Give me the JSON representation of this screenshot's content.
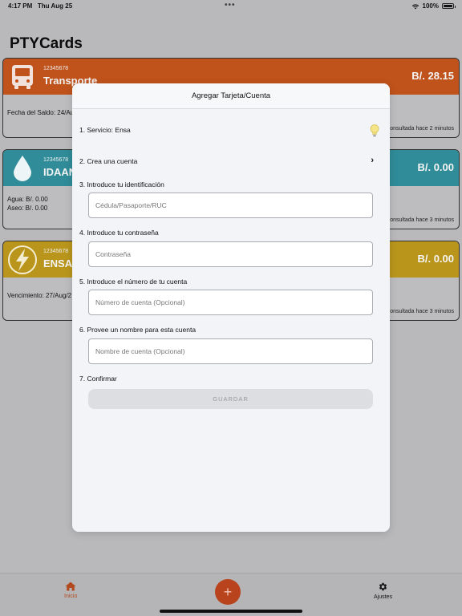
{
  "status_bar": {
    "time": "4:17 PM",
    "date": "Thu Aug 25",
    "battery": "100%"
  },
  "app": {
    "title": "PTYCards"
  },
  "cards": [
    {
      "number": "12345678",
      "name": "Transporte",
      "amount": "B/. 28.15",
      "detail_lines": [
        "Fecha del Saldo: 24/Au"
      ],
      "updated": "consultada hace 2 minutos"
    },
    {
      "number": "12345678",
      "name": "IDAAN",
      "amount": "B/. 0.00",
      "detail_lines": [
        "Agua: B/. 0.00",
        "Aseo: B/. 0.00"
      ],
      "updated": "consultada hace 3 minutos"
    },
    {
      "number": "12345678",
      "name": "ENSA",
      "amount": "B/. 0.00",
      "detail_lines": [
        "Vencimiento: 27/Aug/2"
      ],
      "updated": "consultada hace 3 minutos"
    }
  ],
  "modal": {
    "title": "Agregar Tarjeta/Cuenta",
    "step1": "1. Servicio: Ensa",
    "step2": "2. Crea una cuenta",
    "step3": "3. Introduce tu identificación",
    "step3_placeholder": "Cédula/Pasaporte/RUC",
    "step4": "4. Introduce tu contraseña",
    "step4_placeholder": "Contraseña",
    "step5": "5. Introduce el número de tu cuenta",
    "step5_placeholder": "Número de cuenta (Opcional)",
    "step6": "6. Provee un nombre para esta cuenta",
    "step6_placeholder": "Nombre de cuenta (Opcional)",
    "step7": "7. Confirmar",
    "save_label": "GUARDAR"
  },
  "tab_bar": {
    "home_label": "Inicio",
    "add_label": "+",
    "settings_label": "Ajustes"
  },
  "icons": {
    "transporte": "bus-icon",
    "idaan": "water-drop-icon",
    "ensa": "lightning-icon",
    "hint": "lightbulb-icon",
    "create_account": "chevron-right-icon",
    "home": "home-icon",
    "settings": "gear-icon"
  },
  "colors": {
    "transporte": "#c0521b",
    "idaan": "#2f8c98",
    "ensa": "#b9961b",
    "accent": "#b8431d"
  }
}
